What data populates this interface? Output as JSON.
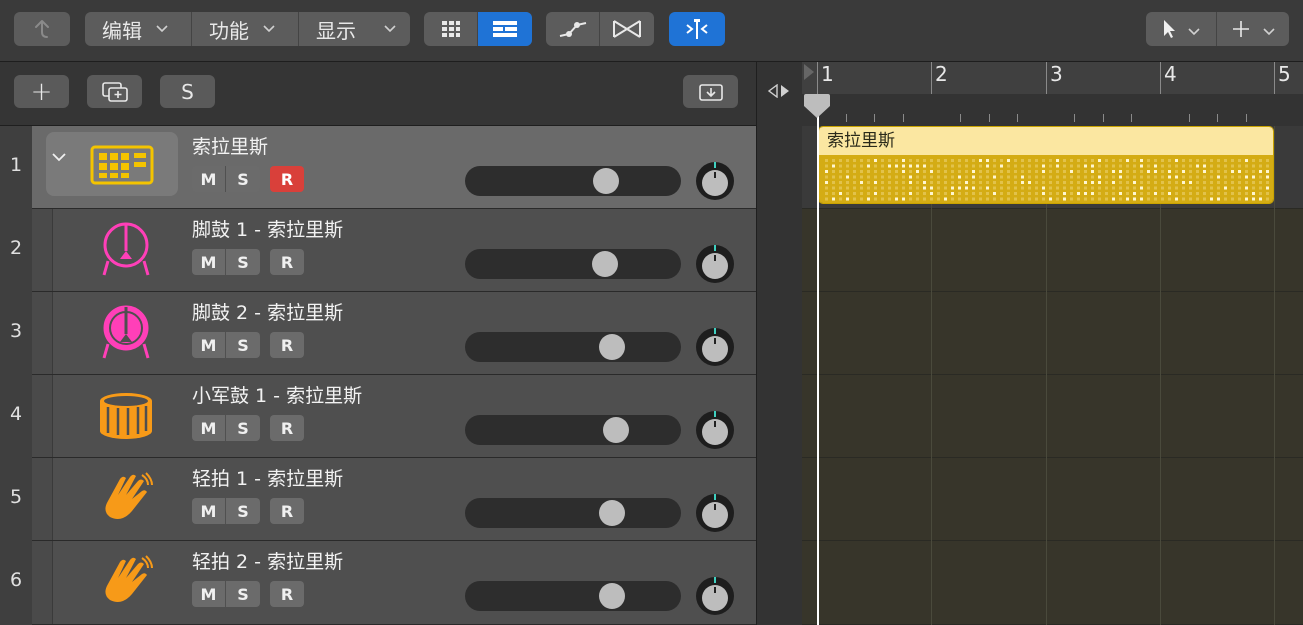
{
  "toolbar": {
    "back_icon": "back-arrow-icon",
    "menus": [
      {
        "label": "编辑"
      },
      {
        "label": "功能"
      },
      {
        "label": "显示"
      }
    ],
    "chevron": "⌄",
    "view_buttons": [
      "grid-view-icon",
      "list-view-icon"
    ],
    "automation_icons": [
      "automation-icon",
      "crossfade-icon"
    ],
    "snap_icon": "snap-icon",
    "tools": [
      "pointer-tool-icon",
      "marquee-tool-icon"
    ]
  },
  "header_bar": {
    "add_label": "+",
    "duplicate_icon": "duplicate-track-icon",
    "s_label": "S",
    "download_icon": "download-icon"
  },
  "tracks": [
    {
      "num": "1",
      "name": "索拉里斯",
      "icon": "drum-machine-icon",
      "color": "#f4c400",
      "fader": 0.68,
      "armed": true,
      "stack": true
    },
    {
      "num": "2",
      "name": "脚鼓 1 - 索拉里斯",
      "icon": "kick-drum-icon",
      "color": "#ff3fb8",
      "fader": 0.67,
      "armed": false,
      "stack": false
    },
    {
      "num": "3",
      "name": "脚鼓 2 - 索拉里斯",
      "icon": "kick-drum-filled-icon",
      "color": "#ff3fb8",
      "fader": 0.71,
      "armed": false,
      "stack": false
    },
    {
      "num": "4",
      "name": "小军鼓 1 - 索拉里斯",
      "icon": "snare-drum-icon",
      "color": "#f79a18",
      "fader": 0.73,
      "armed": false,
      "stack": false
    },
    {
      "num": "5",
      "name": "轻拍 1 - 索拉里斯",
      "icon": "clap-icon",
      "color": "#f79a18",
      "fader": 0.71,
      "armed": false,
      "stack": false
    },
    {
      "num": "6",
      "name": "轻拍 2 - 索拉里斯",
      "icon": "clap-icon",
      "color": "#f79a18",
      "fader": 0.71,
      "armed": false,
      "stack": false
    }
  ],
  "msr": {
    "m": "M",
    "s": "S",
    "r": "R"
  },
  "ruler": {
    "bars": [
      "1",
      "2",
      "3",
      "4",
      "5"
    ]
  },
  "region": {
    "name": "索拉里斯",
    "color": "#d4ac14",
    "header_color": "#fbe7a1"
  },
  "colors": {
    "accent": "#1f73d6",
    "record": "#d9403a"
  }
}
